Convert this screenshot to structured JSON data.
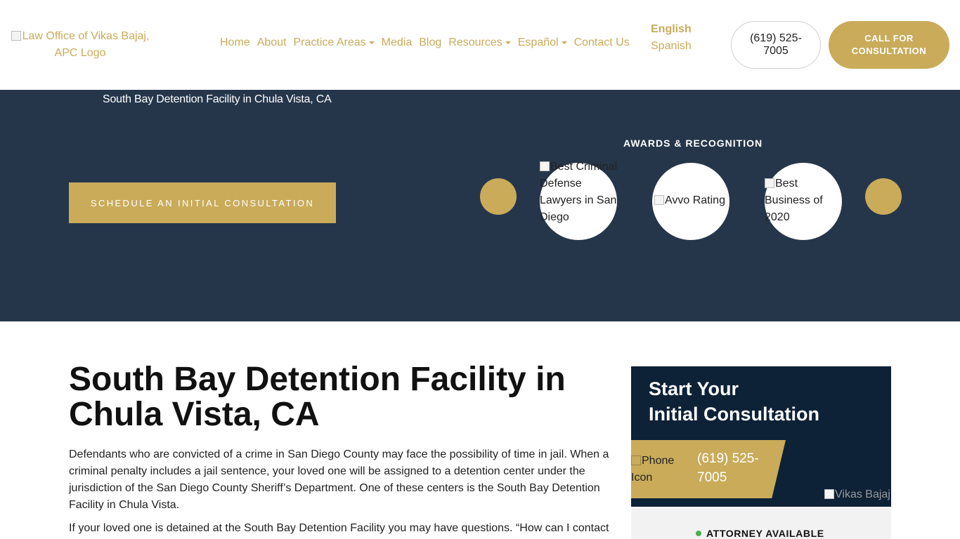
{
  "header": {
    "logo_alt": "Law Office of Vikas Bajaj, APC Logo",
    "nav": [
      {
        "label": "Home",
        "dropdown": false
      },
      {
        "label": "About",
        "dropdown": false
      },
      {
        "label": "Practice Areas",
        "dropdown": true
      },
      {
        "label": "Media",
        "dropdown": false
      },
      {
        "label": "Blog",
        "dropdown": false
      },
      {
        "label": "Resources",
        "dropdown": true
      },
      {
        "label": "Español",
        "dropdown": true
      },
      {
        "label": "Contact Us",
        "dropdown": false
      }
    ],
    "languages": {
      "english": "English",
      "spanish": "Spanish"
    },
    "phone": "(619) 525-7005",
    "cta": "CALL FOR CONSULTATION"
  },
  "hero": {
    "breadcrumb": "South Bay Detention Facility in Chula Vista, CA",
    "schedule_button": "SCHEDULE AN INITIAL CONSULTATION",
    "awards_title": "AWARDS & RECOGNITION",
    "badges": [
      {
        "alt": "Best Criminal Defense Lawyers in San Diego"
      },
      {
        "alt": "Avvo Rating"
      },
      {
        "alt": "Best Business of 2020"
      }
    ]
  },
  "main": {
    "title": "South Bay Detention Facility in Chula Vista, CA",
    "paragraph1": "Defendants who are convicted of a crime in San Diego County may face the possibility of time in jail. When a criminal penalty includes a jail sentence, your loved one will be assigned to a detention center under the jurisdiction of the San Diego County Sheriff’s Department. One of these centers is the South Bay Detention Facility in Chula Vista.",
    "paragraph2": "If your loved one is detained at the South Bay Detention Facility you may have questions. “How can I contact"
  },
  "sidebar": {
    "title_line1": "Start Your",
    "title_line2": "Initial Consultation",
    "phone_icon_alt": "Phone Icon",
    "phone": "(619) 525-7005",
    "photo_alt": "Vikas Bajaj",
    "availability": "ATTORNEY AVAILABLE"
  },
  "colors": {
    "gold": "#c9ab5a",
    "navy_hero": "#26364a",
    "navy_sidebar": "#0d2137",
    "available_dot": "#4caf50"
  }
}
